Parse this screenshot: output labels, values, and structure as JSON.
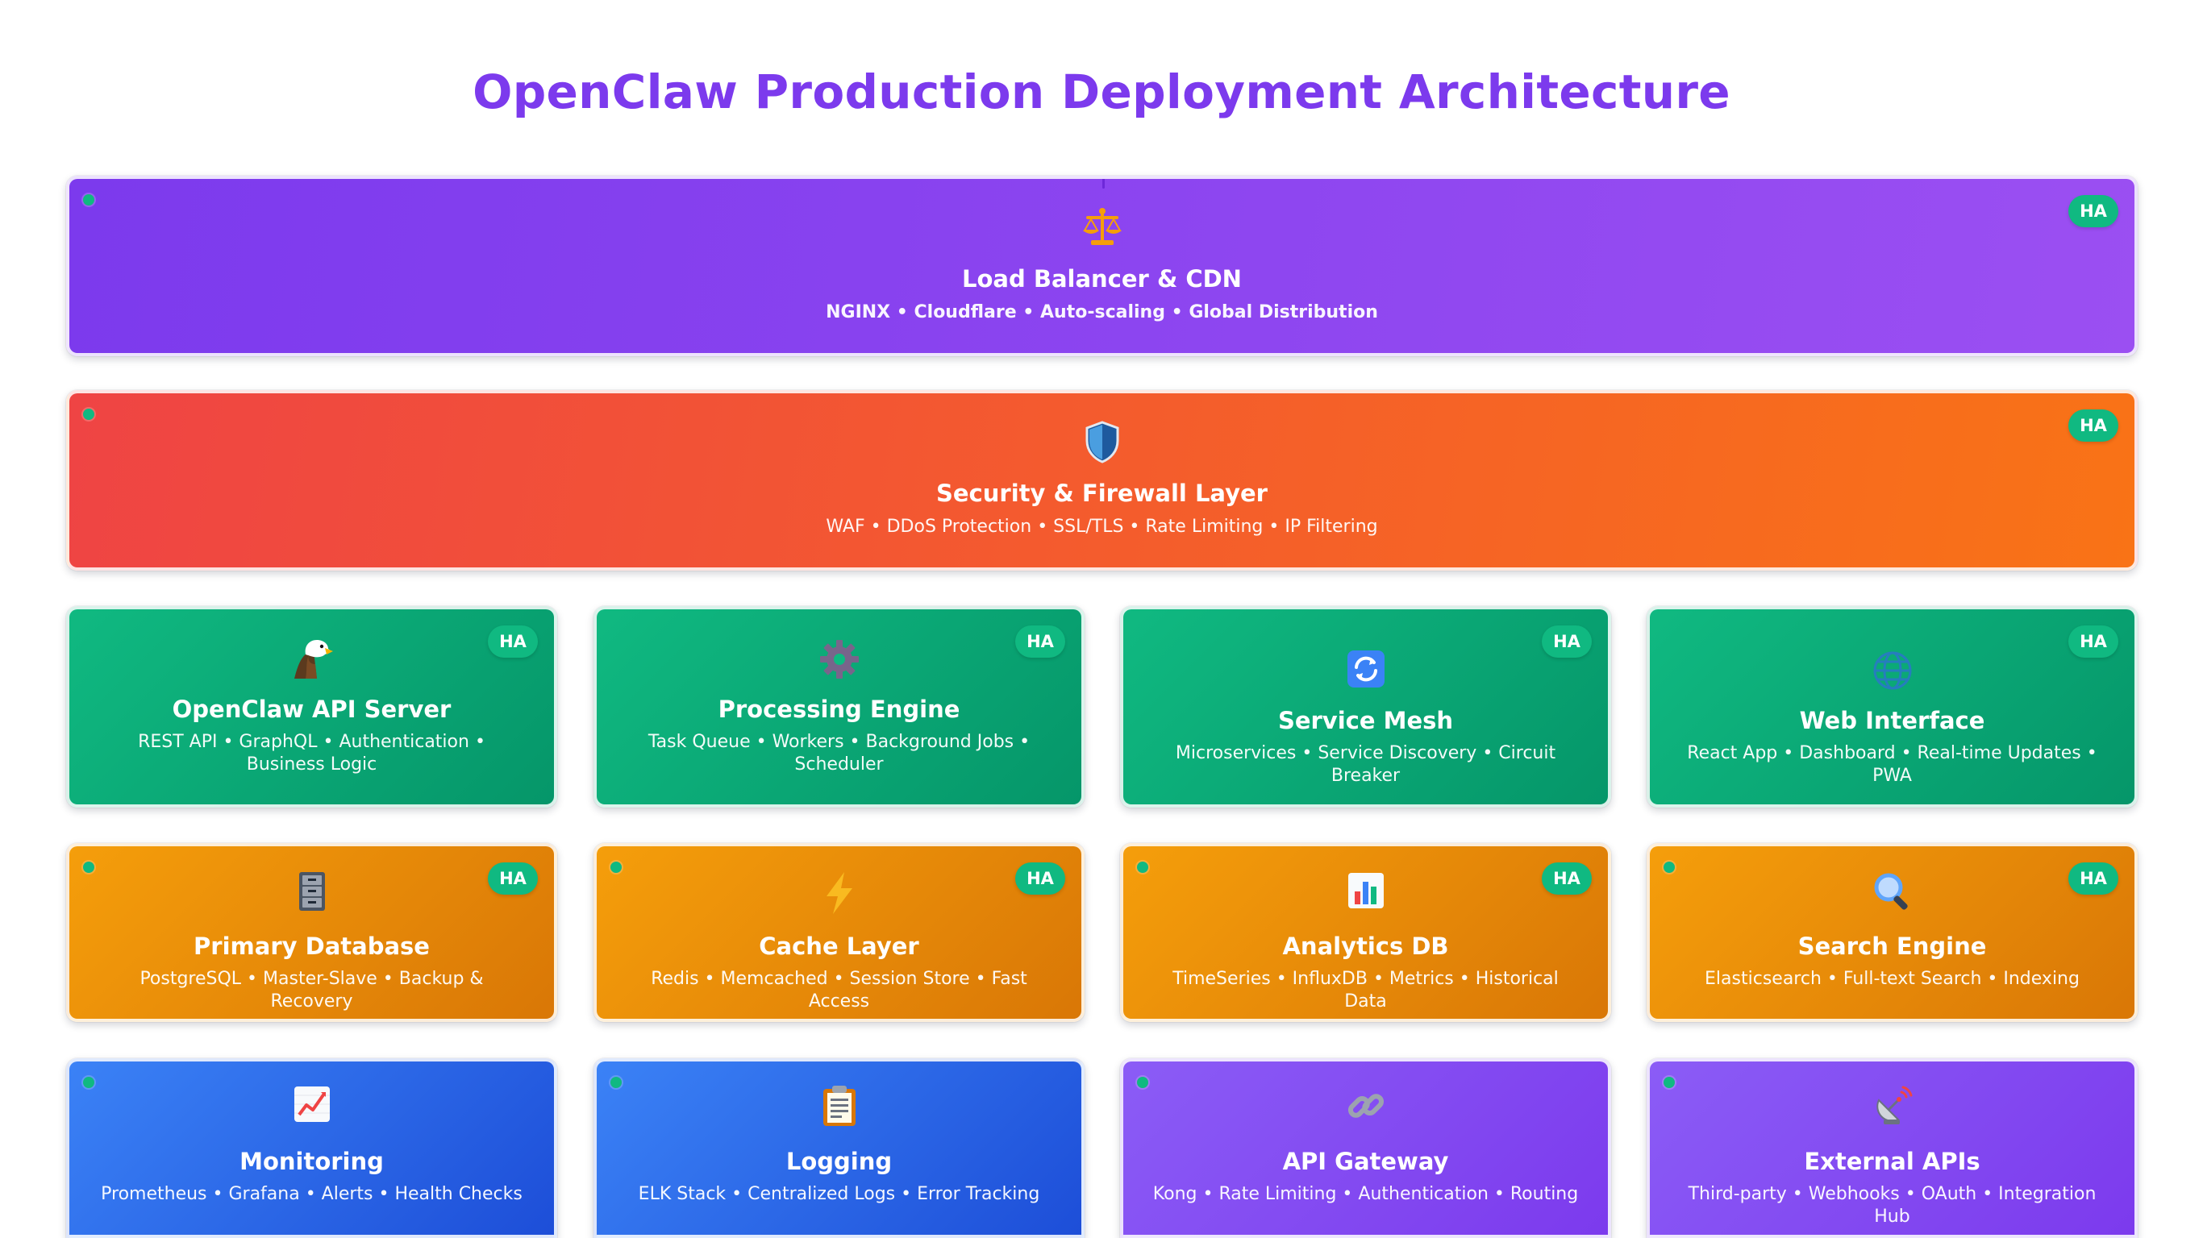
{
  "title": "OpenClaw Production Deployment Architecture",
  "colors": {
    "title": "#7c3aed",
    "ha_badge": "#10b981",
    "status_dot": "#10b981"
  },
  "layers": {
    "load_balancer": {
      "icon": "balance-scale-icon",
      "name": "Load Balancer & CDN",
      "desc": "NGINX • Cloudflare • Auto-scaling • Global Distribution",
      "badge": "HA"
    },
    "security": {
      "icon": "shield-icon",
      "name": "Security & Firewall Layer",
      "desc": "WAF • DDoS Protection • SSL/TLS • Rate Limiting • IP Filtering",
      "badge": "HA"
    }
  },
  "services": [
    {
      "icon": "eagle-icon",
      "name": "OpenClaw API Server",
      "desc": "REST API • GraphQL • Authentication • Business Logic",
      "badge": "HA"
    },
    {
      "icon": "gear-icon",
      "name": "Processing Engine",
      "desc": "Task Queue • Workers • Background Jobs • Scheduler",
      "badge": "HA"
    },
    {
      "icon": "sync-icon",
      "name": "Service Mesh",
      "desc": "Microservices • Service Discovery • Circuit Breaker",
      "badge": "HA"
    },
    {
      "icon": "globe-icon",
      "name": "Web Interface",
      "desc": "React App • Dashboard • Real-time Updates • PWA",
      "badge": "HA"
    }
  ],
  "data_tier": [
    {
      "icon": "file-cabinet-icon",
      "name": "Primary Database",
      "desc": "PostgreSQL • Master-Slave • Backup & Recovery",
      "badge": "HA"
    },
    {
      "icon": "lightning-icon",
      "name": "Cache Layer",
      "desc": "Redis • Memcached • Session Store • Fast Access",
      "badge": "HA"
    },
    {
      "icon": "bar-chart-icon",
      "name": "Analytics DB",
      "desc": "TimeSeries • InfluxDB • Metrics • Historical Data",
      "badge": "HA"
    },
    {
      "icon": "magnifier-icon",
      "name": "Search Engine",
      "desc": "Elasticsearch • Full-text Search • Indexing",
      "badge": "HA"
    }
  ],
  "ops_tier": [
    {
      "icon": "trend-chart-icon",
      "name": "Monitoring",
      "desc": "Prometheus • Grafana • Alerts • Health Checks"
    },
    {
      "icon": "clipboard-icon",
      "name": "Logging",
      "desc": "ELK Stack • Centralized Logs • Error Tracking"
    },
    {
      "icon": "link-icon",
      "name": "API Gateway",
      "desc": "Kong • Rate Limiting • Authentication • Routing"
    },
    {
      "icon": "satellite-icon",
      "name": "External APIs",
      "desc": "Third-party • Webhooks • OAuth • Integration Hub"
    }
  ]
}
